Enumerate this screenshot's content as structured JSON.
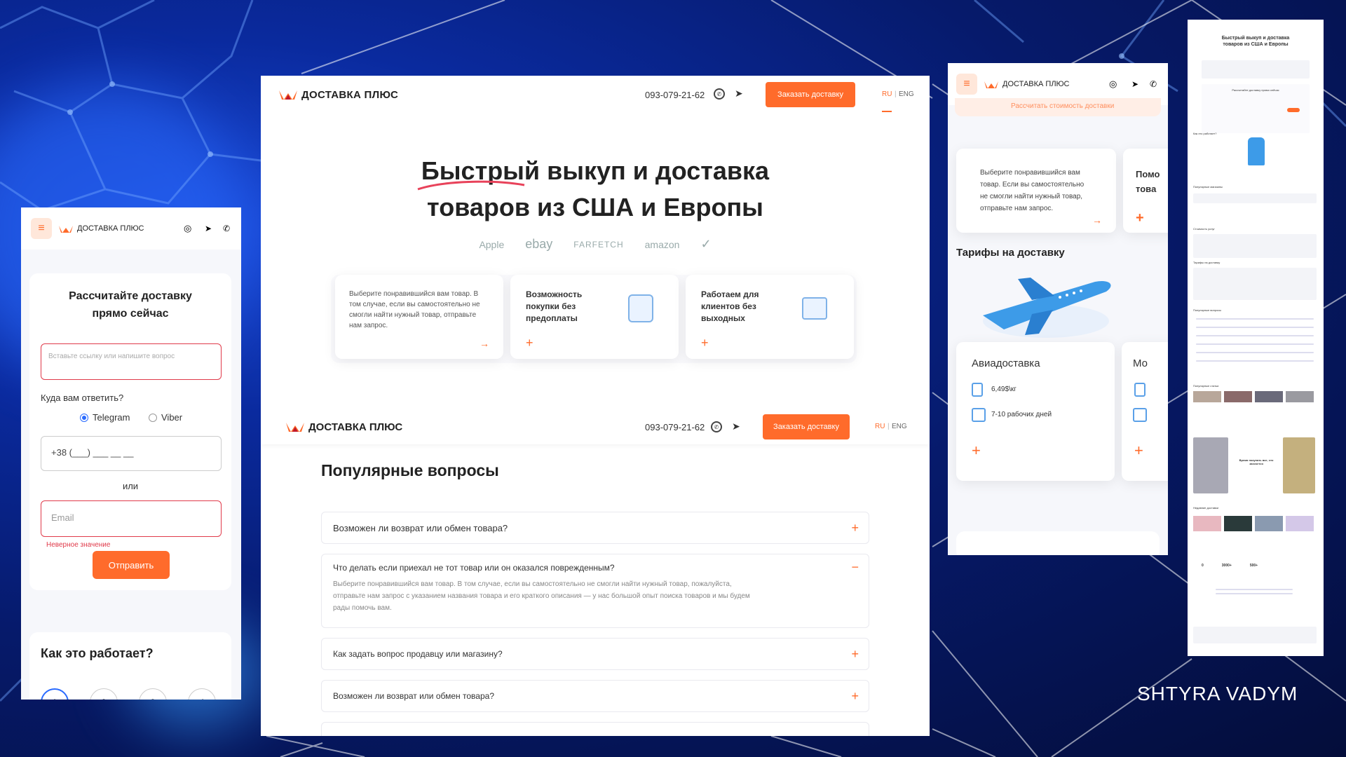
{
  "brand": {
    "name": "ДОСТАВКА ПЛЮС",
    "accent": "#ff6b2b",
    "bg": "#061a6b"
  },
  "desktop": {
    "header": {
      "phone": "093-079-21-62",
      "order_button": "Заказать доставку",
      "lang_ru": "RU",
      "lang_sep": "|",
      "lang_en": "ENG"
    },
    "hero": {
      "title_highlight": "Быстрый",
      "title_rest": " выкуп и доставка",
      "title_line2": "товаров из США и Европы"
    },
    "brands": [
      "Apple",
      "ebay",
      "FARFETCH",
      "amazon"
    ],
    "features": [
      {
        "text": "Выберите понравившийся вам товар. В том случае, если вы самостоятельно не смогли найти нужный товар, отправьте нам запрос."
      },
      {
        "title": "Возможность покупки без предоплаты"
      },
      {
        "title": "Работаем для клиентов без выходных"
      }
    ]
  },
  "faq_page": {
    "header": {
      "phone": "093-079-21-62",
      "order_button": "Заказать доставку",
      "lang_ru": "RU",
      "lang_sep": "|",
      "lang_en": "ENG"
    },
    "title": "Популярные вопросы",
    "items": [
      {
        "q": "Возможен ли возврат или обмен товара?"
      },
      {
        "q": "Что делать если приехал не тот товар или он оказался поврежденным?",
        "a": "Выберите понравившийся вам товар. В том случае, если вы самостоятельно не смогли найти нужный товар, пожалуйста, отправьте нам запрос с указанием названия товара и его краткого описания — у нас большой опыт поиска товаров и мы будем рады помочь вам."
      },
      {
        "q": "Как задать вопрос продавцу или магазину?"
      },
      {
        "q": "Возможен ли возврат или обмен товара?"
      }
    ]
  },
  "mobile_left": {
    "form_title_1": "Рассчитайте доставку",
    "form_title_2": "прямо сейчас",
    "link_placeholder": "Вставьте ссылку или напишите вопрос",
    "answer_label": "Куда вам ответить?",
    "radio_telegram": "Telegram",
    "radio_viber": "Viber",
    "phone_mask": "+38 (___) ___ __ __",
    "or": "или",
    "email_placeholder": "Email",
    "error": "Неверное значение",
    "submit": "Отправить",
    "how_title": "Как это работает?",
    "steps": [
      "1",
      "2",
      "3",
      "4"
    ]
  },
  "mobile_right": {
    "calc_banner": "Рассчитать стоимость доставки",
    "card_text": "Выберите понравившийся вам товар. Если вы самостоятельно не смогли найти нужный товар, отправьте нам запрос.",
    "card2_partial": "Помо товa",
    "tariffs_title": "Тарифы на доставку",
    "air_title": "Авиадоставка",
    "air_price": "6,49$\\кг",
    "air_days": "7-10 рабочих дней",
    "sea_partial": "Мо"
  },
  "full_page_preview": {
    "title_1": "Быстрый выкуп и доставка",
    "title_2": "товаров из США и Европы",
    "calc_title": "Рассчитайте доставку прямо сейчас",
    "how": "Как это работает?",
    "shops": "Популярные магазины",
    "prices": "Стоимость услуг",
    "tariffs": "Тарифы на доставку",
    "faq": "Популярные вопросы",
    "articles": "Популярные статьи",
    "promo": "Время покупать все, что захочется",
    "deliveries": "Недавние доставки",
    "stats": [
      "0",
      "3000+",
      "500+"
    ]
  },
  "author": "SHTYRA VADYM"
}
